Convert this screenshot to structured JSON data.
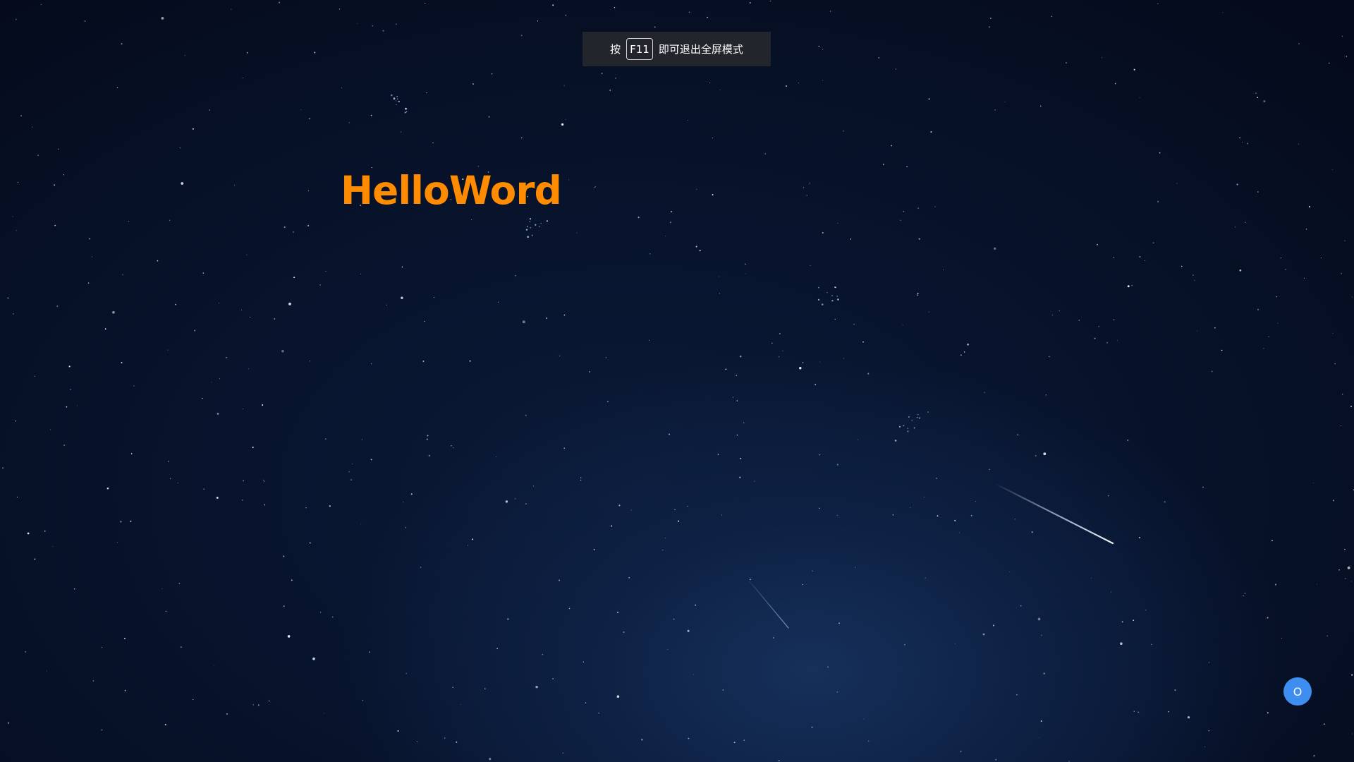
{
  "toast": {
    "prefix": "按",
    "key": "F11",
    "suffix": "即可退出全屏模式"
  },
  "page": {
    "title": "HelloWord"
  },
  "float_button": {
    "label": "O"
  },
  "colors": {
    "title": "#ff8c00",
    "float_button": "#3d8ef0",
    "toast_bg": "#22262c",
    "sky_dark": "#050b1c",
    "sky_glow": "#16305a"
  }
}
